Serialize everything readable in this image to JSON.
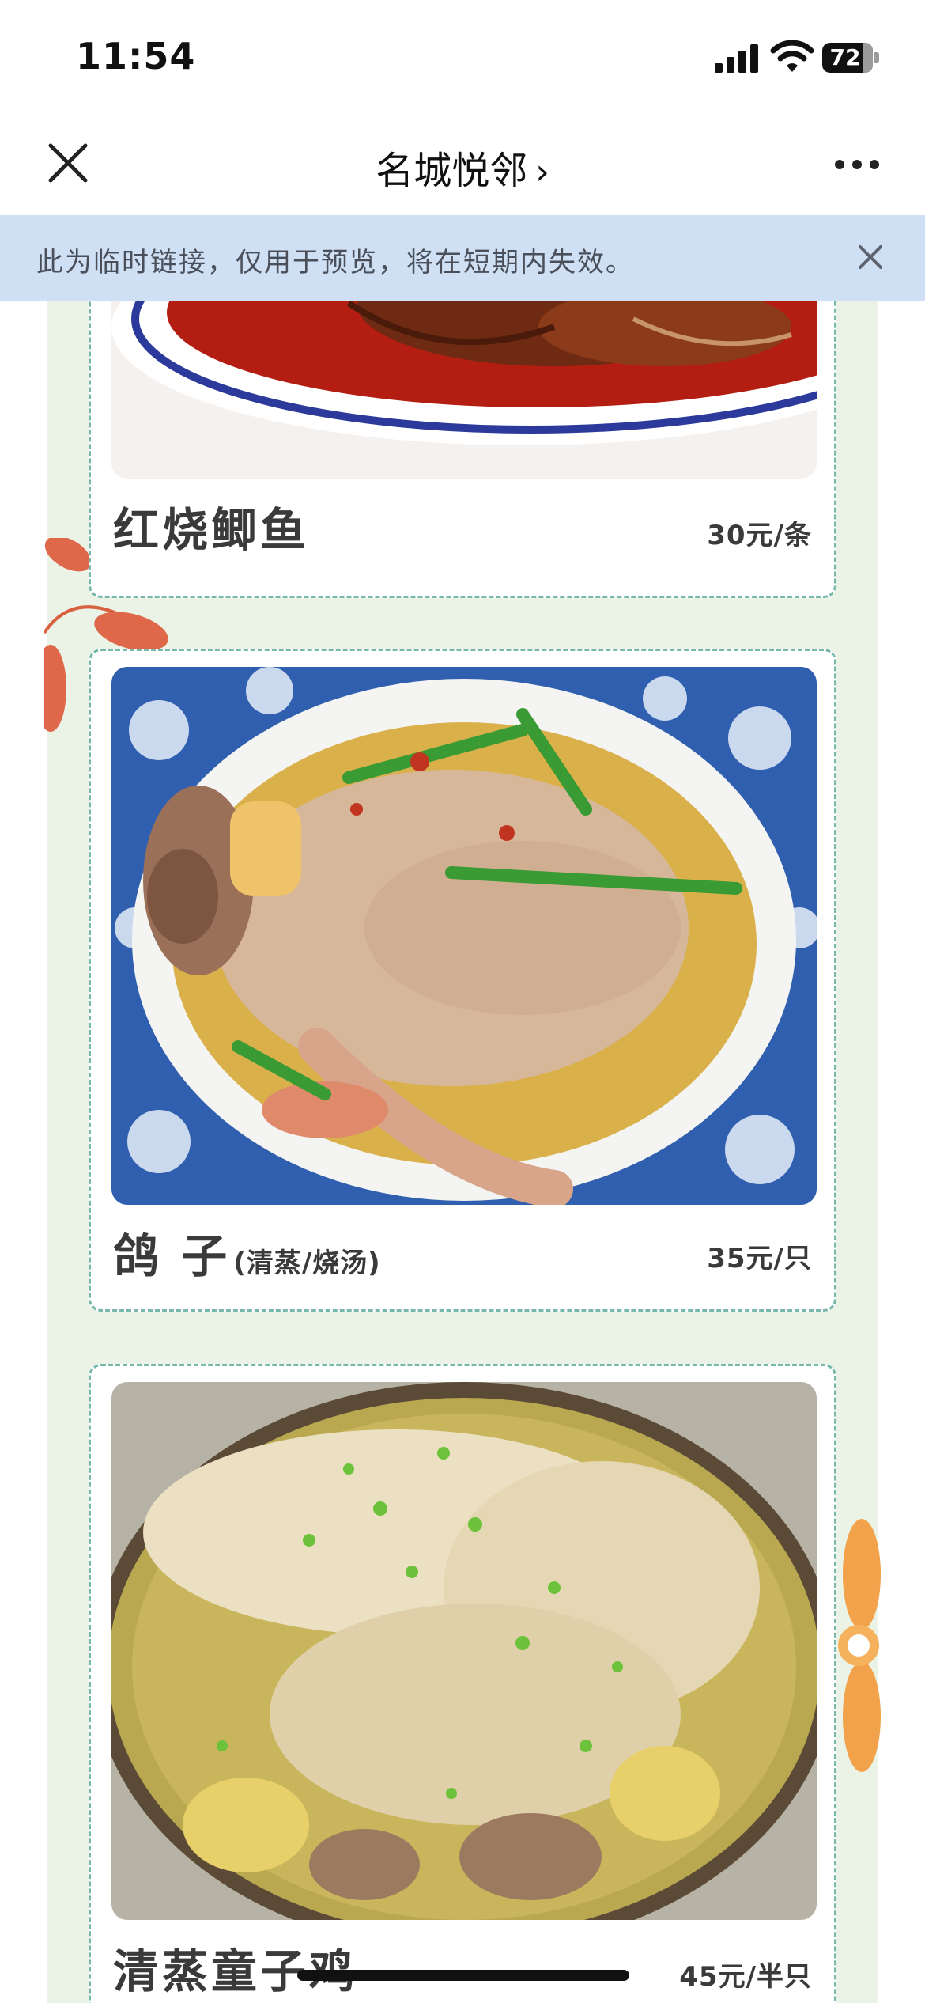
{
  "status_bar": {
    "time": "11:54",
    "battery_level": "72",
    "icons": [
      "cellular-signal-icon",
      "wifi-icon",
      "battery-icon"
    ]
  },
  "nav": {
    "title": "名城悦邻",
    "title_chevron": "›",
    "close_icon": "close-icon",
    "more_icon": "more-dots-icon"
  },
  "notice": {
    "text": "此为临时链接，仅用于预览，将在短期内失效。",
    "close_icon": "close-icon",
    "background": "#cfe0f4"
  },
  "dishes": [
    {
      "name": "红烧鲫鱼",
      "note": "",
      "price": "30元/条",
      "photo": "braised-crucian-carp-photo"
    },
    {
      "name": "鸽 子",
      "note": "(清蒸/烧汤)",
      "price": "35元/只",
      "photo": "pigeon-soup-photo"
    },
    {
      "name": "清蒸童子鸡",
      "note": "",
      "price": "45元/半只",
      "photo": "steamed-spring-chicken-photo"
    }
  ],
  "colors": {
    "page_background": "#eaf3e6",
    "card_border": "#76b8ac",
    "dish_text": "#3a3a3a"
  }
}
